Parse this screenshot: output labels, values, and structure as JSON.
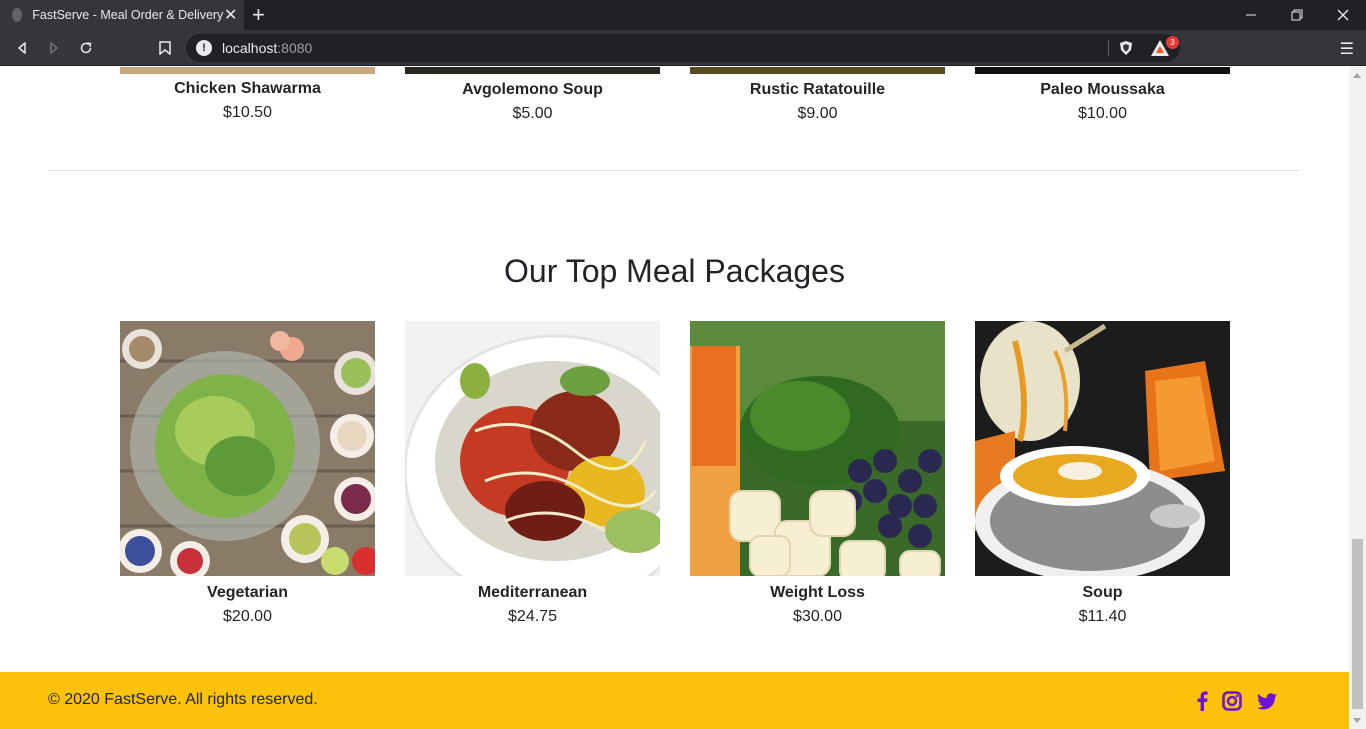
{
  "browser": {
    "tab_title": "FastServe - Meal Order & Delivery",
    "url_host": "localhost",
    "url_port": ":8080",
    "rewards_badge": "3"
  },
  "top_items": [
    {
      "name": "Chicken Shawarma",
      "price": "$10.50"
    },
    {
      "name": "Avgolemono Soup",
      "price": "$5.00"
    },
    {
      "name": "Rustic Ratatouille",
      "price": "$9.00"
    },
    {
      "name": "Paleo Moussaka",
      "price": "$10.00"
    }
  ],
  "packages": {
    "title": "Our Top Meal Packages",
    "items": [
      {
        "name": "Vegetarian",
        "price": "$20.00"
      },
      {
        "name": "Mediterranean",
        "price": "$24.75"
      },
      {
        "name": "Weight Loss",
        "price": "$30.00"
      },
      {
        "name": "Soup",
        "price": "$11.40"
      }
    ]
  },
  "footer": {
    "copyright": "© 2020 FastServe. All rights reserved.",
    "social_icons": [
      "facebook-icon",
      "instagram-icon",
      "twitter-icon"
    ]
  },
  "colors": {
    "footer_bg": "#fcc10a",
    "social": "#6d12d9"
  }
}
